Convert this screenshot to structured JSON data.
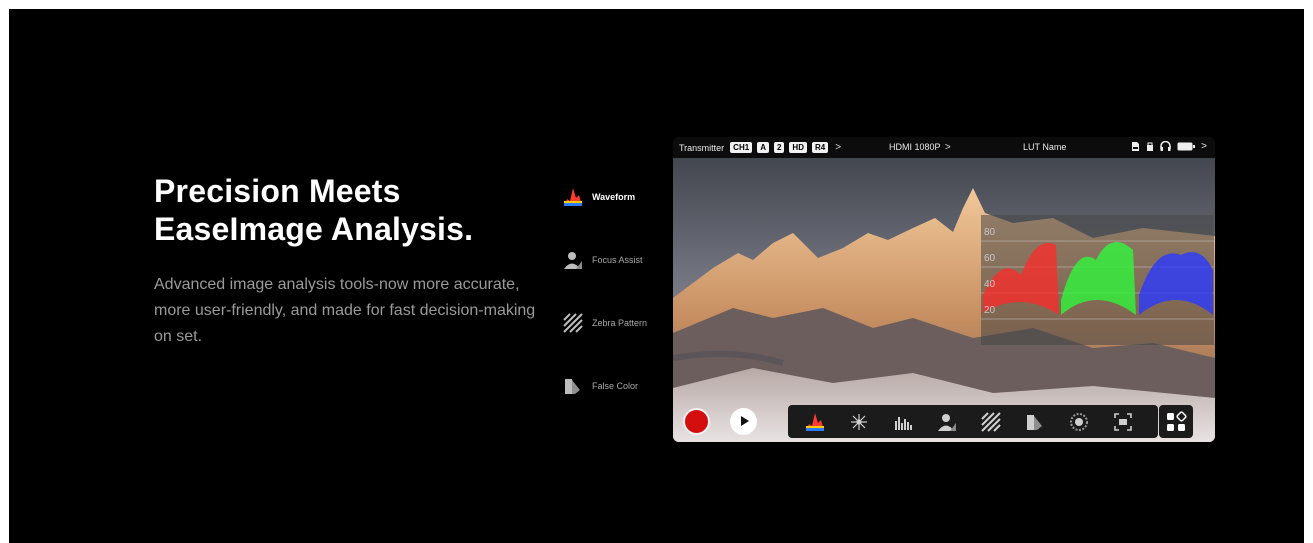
{
  "hero": {
    "title_line1": "Precision Meets",
    "title_line2": "EaseImage Analysis.",
    "description": "Advanced image analysis tools-now more accurate, more user-friendly, and made for fast decision-making on set."
  },
  "features": [
    {
      "label": "Waveform",
      "icon": "waveform-icon",
      "active": true
    },
    {
      "label": "Focus Assist",
      "icon": "focus-assist-icon",
      "active": false
    },
    {
      "label": "Zebra Pattern",
      "icon": "zebra-pattern-icon",
      "active": false
    },
    {
      "label": "False Color",
      "icon": "false-color-icon",
      "active": false
    }
  ],
  "monitor": {
    "status_bar": {
      "transmitter": "Transmitter",
      "badges": [
        "CH1",
        "A",
        "2",
        "HD",
        "R4"
      ],
      "chevron": ">",
      "input": "HDMI 1080P",
      "lut": "LUT Name",
      "right_icons": [
        "sd-card-icon",
        "lock-icon",
        "headphones-icon",
        "battery-icon",
        "chevron-right-icon"
      ]
    },
    "waveform_scale": [
      "80",
      "60",
      "40",
      "20"
    ],
    "toolbar_icons": [
      "waveform-icon",
      "vectorscope-icon",
      "histogram-icon",
      "focus-assist-icon",
      "zebra-icon",
      "false-color-icon",
      "color-wheel-icon",
      "frame-guide-icon"
    ],
    "apps_icon": "apps-icon"
  },
  "colors": {
    "background": "#000000",
    "record": "#d40e0e",
    "waveform_red": "#ff2a2a",
    "waveform_green": "#2aff3a",
    "waveform_blue": "#2a3aff"
  }
}
